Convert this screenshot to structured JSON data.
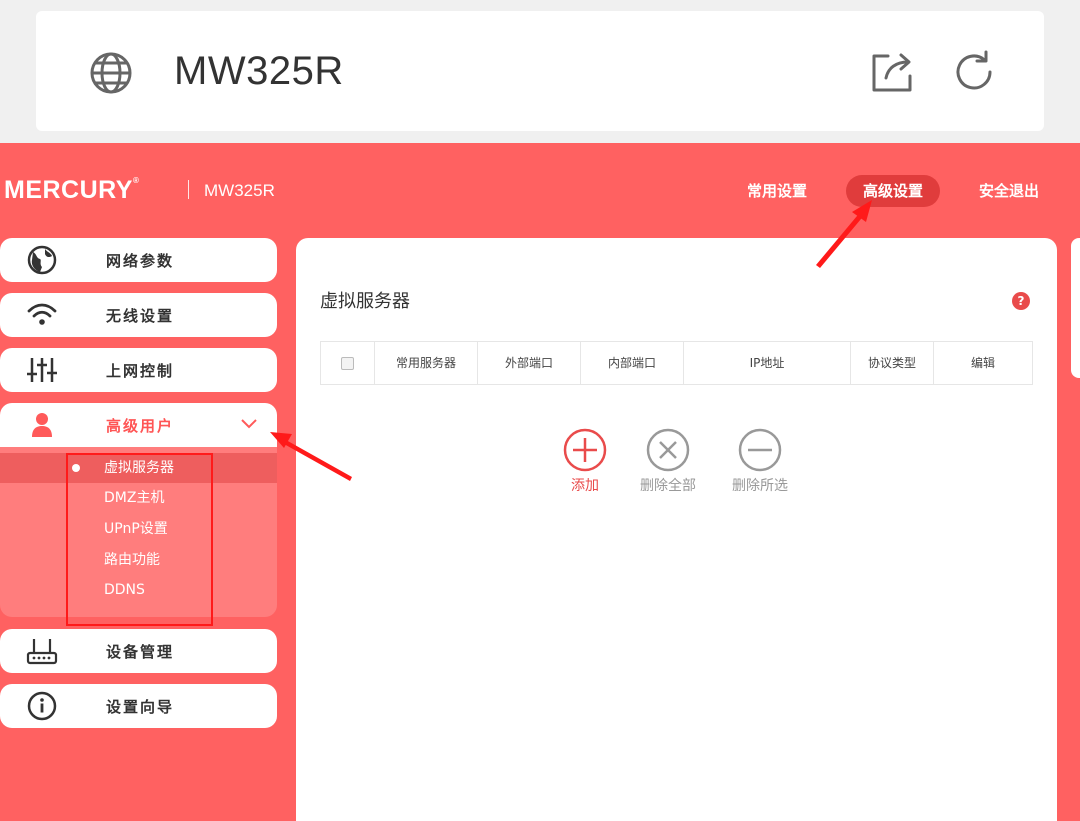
{
  "browser": {
    "host": "MW325R",
    "icons": [
      "globe-icon",
      "share-icon",
      "reload-icon"
    ]
  },
  "header": {
    "brand": "MERCURY",
    "model": "MW325R",
    "nav": [
      {
        "label": "常用设置",
        "active": false
      },
      {
        "label": "高级设置",
        "active": true
      },
      {
        "label": "安全退出",
        "active": false
      }
    ]
  },
  "sidebar": {
    "items": [
      {
        "label": "网络参数",
        "icon": "globe-icon"
      },
      {
        "label": "无线设置",
        "icon": "wifi-icon"
      },
      {
        "label": "上网控制",
        "icon": "sliders-icon"
      },
      {
        "label": "高级用户",
        "icon": "user-icon",
        "expanded": true
      },
      {
        "label": "设备管理",
        "icon": "router-icon"
      },
      {
        "label": "设置向导",
        "icon": "info-icon"
      }
    ],
    "submenu": [
      {
        "label": "虚拟服务器",
        "active": true
      },
      {
        "label": "DMZ主机"
      },
      {
        "label": "UPnP设置"
      },
      {
        "label": "路由功能"
      },
      {
        "label": "DDNS"
      }
    ]
  },
  "main": {
    "title": "虚拟服务器",
    "help": "?",
    "columns": [
      "常用服务器",
      "外部端口",
      "内部端口",
      "IP地址",
      "协议类型",
      "编辑"
    ],
    "actions": {
      "add": "添加",
      "delete_all": "删除全部",
      "delete_selected": "删除所选"
    }
  },
  "colors": {
    "accent": "#ff6161",
    "active_pill": "#e03c3c",
    "annotation": "#ff1a1a"
  }
}
